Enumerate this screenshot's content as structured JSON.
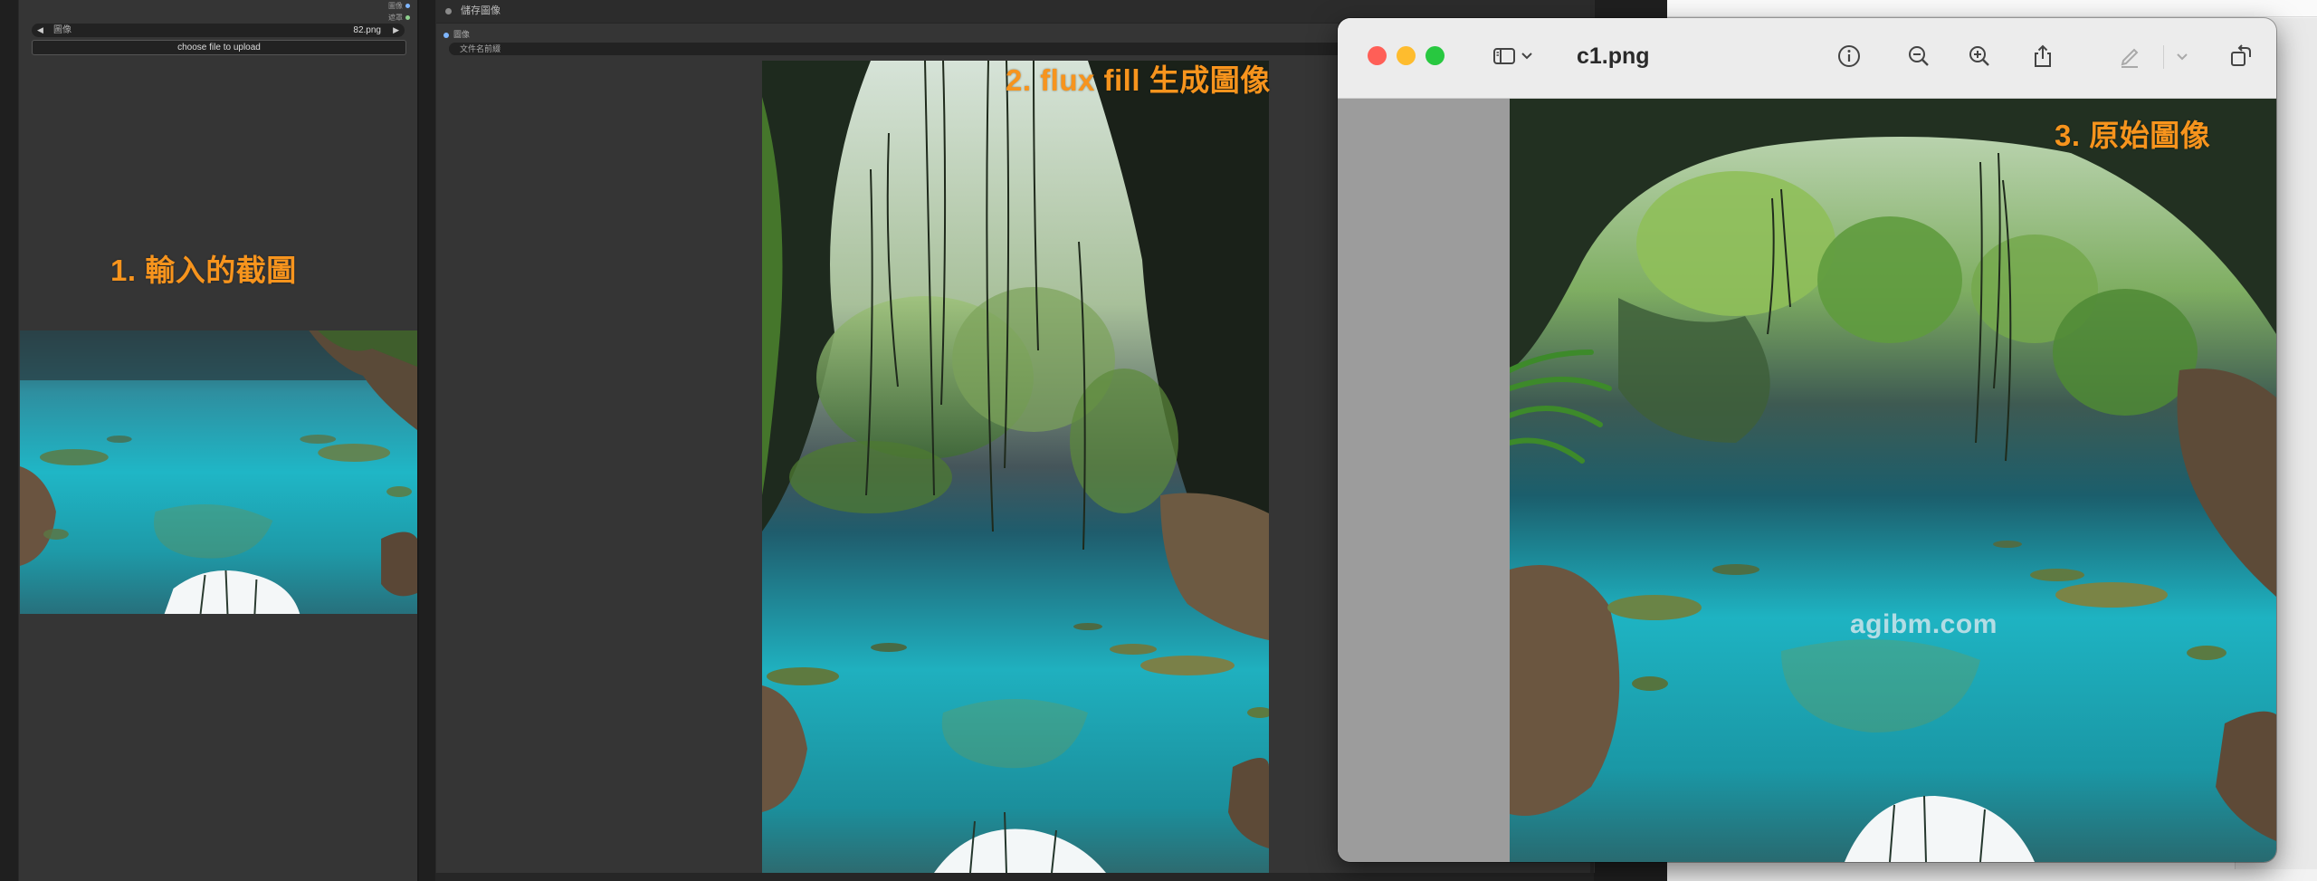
{
  "left_node": {
    "slot_labels": [
      "圖像",
      "遮罩"
    ],
    "combo_label": "圖像",
    "combo_value": "82.png",
    "combo_prev": "◀",
    "combo_next": "▶",
    "upload_button": "choose file to upload",
    "caption": "1. 輸入的截圖"
  },
  "mid_node": {
    "title": "儲存圖像",
    "slot_label": "圖像",
    "filename_prefix": "文件名前綴",
    "caption": "2. flux fill 生成圖像"
  },
  "preview": {
    "title": "c1.png",
    "caption": "3. 原始圖像",
    "watermark": "agibm.com",
    "toolbar_icons": [
      "sidebar-toggle-icon",
      "chevron-down-icon",
      "info-icon",
      "zoom-out-icon",
      "zoom-in-icon",
      "share-icon",
      "markup-pen-icon",
      "chevron-down-icon",
      "rotate-icon"
    ],
    "traffic_colors": {
      "close": "#ff5f57",
      "minimize": "#febc2e",
      "zoom": "#28c840"
    }
  },
  "colors": {
    "caption": "#f7941d",
    "water": "#1fb8c4",
    "node_bg": "#353535"
  }
}
